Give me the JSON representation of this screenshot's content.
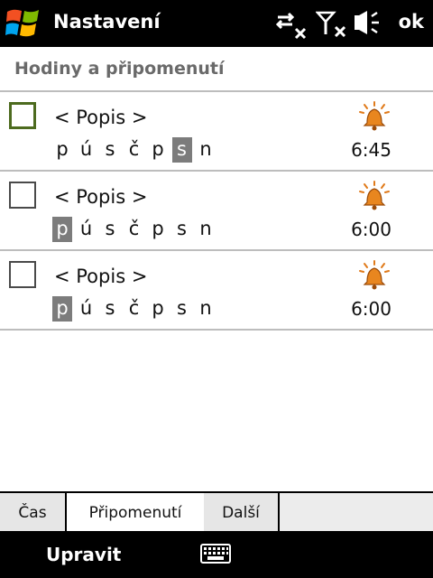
{
  "titlebar": {
    "title": "Nastavení",
    "ok_label": "ok",
    "icons": [
      "windows-start-icon",
      "connectivity-icon",
      "signal-off-icon",
      "speaker-vibrate-icon"
    ]
  },
  "section": {
    "title": "Hodiny a připomenutí"
  },
  "alarms": [
    {
      "description": "< Popis >",
      "days": [
        "p",
        "ú",
        "s",
        "č",
        "p",
        "s",
        "n"
      ],
      "active_days": [
        false,
        false,
        false,
        false,
        false,
        true,
        false
      ],
      "time": "6:45",
      "checked": false,
      "focused": true
    },
    {
      "description": "< Popis >",
      "days": [
        "p",
        "ú",
        "s",
        "č",
        "p",
        "s",
        "n"
      ],
      "active_days": [
        true,
        false,
        false,
        false,
        false,
        false,
        false
      ],
      "time": "6:00",
      "checked": false,
      "focused": false
    },
    {
      "description": "< Popis >",
      "days": [
        "p",
        "ú",
        "s",
        "č",
        "p",
        "s",
        "n"
      ],
      "active_days": [
        true,
        false,
        false,
        false,
        false,
        false,
        false
      ],
      "time": "6:00",
      "checked": false,
      "focused": false
    }
  ],
  "tabs": [
    {
      "label": "Čas",
      "active": false
    },
    {
      "label": "Připomenutí",
      "active": true
    },
    {
      "label": "Další",
      "active": false
    }
  ],
  "softkeys": {
    "left": "Upravit",
    "center_icon": "keyboard-icon"
  },
  "colors": {
    "bar_bg": "#000000",
    "active_day_bg": "#7c7c7c",
    "focus_border": "#4d6b1f",
    "bell": "#e07a1a"
  }
}
